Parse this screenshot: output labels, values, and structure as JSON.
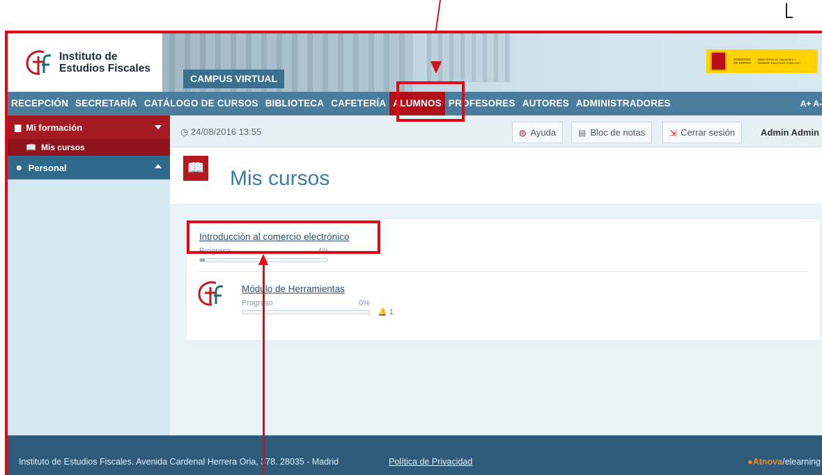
{
  "header": {
    "logo_line1": "Instituto de",
    "logo_line2": "Estudios Fiscales",
    "campus_label": "CAMPUS VIRTUAL",
    "gov_text_left": "GOBIERNO DE ESPAÑA",
    "gov_text_right": "MINISTERIO DE HACIENDA Y ADMINISTRACIONES PÚBLICAS"
  },
  "nav": {
    "items": [
      {
        "label": "RECEPCIÓN"
      },
      {
        "label": "SECRETARÍA"
      },
      {
        "label": "CATÁLOGO DE CURSOS"
      },
      {
        "label": "BIBLIOTECA"
      },
      {
        "label": "CAFETERÍA"
      },
      {
        "label": "ALUMNOS"
      },
      {
        "label": "PROFESORES"
      },
      {
        "label": "AUTORES"
      },
      {
        "label": "ADMINISTRADORES"
      }
    ],
    "font_size": "A+ A-"
  },
  "sidebar": {
    "group1": "Mi formación",
    "sub1": "Mis cursos",
    "group2": "Personal"
  },
  "toolbar": {
    "datetime": "24/08/2016 13:55",
    "help": "Ayuda",
    "notes": "Bloc de notas",
    "logout": "Cerrar sesión",
    "user": "Admin Admin"
  },
  "page": {
    "title": "Mis cursos"
  },
  "courses": [
    {
      "name": "Introducción al comercio electrónico",
      "progress_label": "Progreso",
      "progress_pct": "4%",
      "progress": 0.04
    },
    {
      "name": "Módulo de Herramientas",
      "progress_label": "Progreso",
      "progress_pct": "0%",
      "progress": 0.0,
      "notifications": "1"
    }
  ],
  "footer": {
    "address": "Instituto de Estudios Fiscales. Avenida Cardenal Herrera Oria, 378. 28035 - Madrid",
    "privacy": "Política de Privacidad",
    "brand_accent": "Atnova",
    "brand_rest": "/elearning"
  }
}
